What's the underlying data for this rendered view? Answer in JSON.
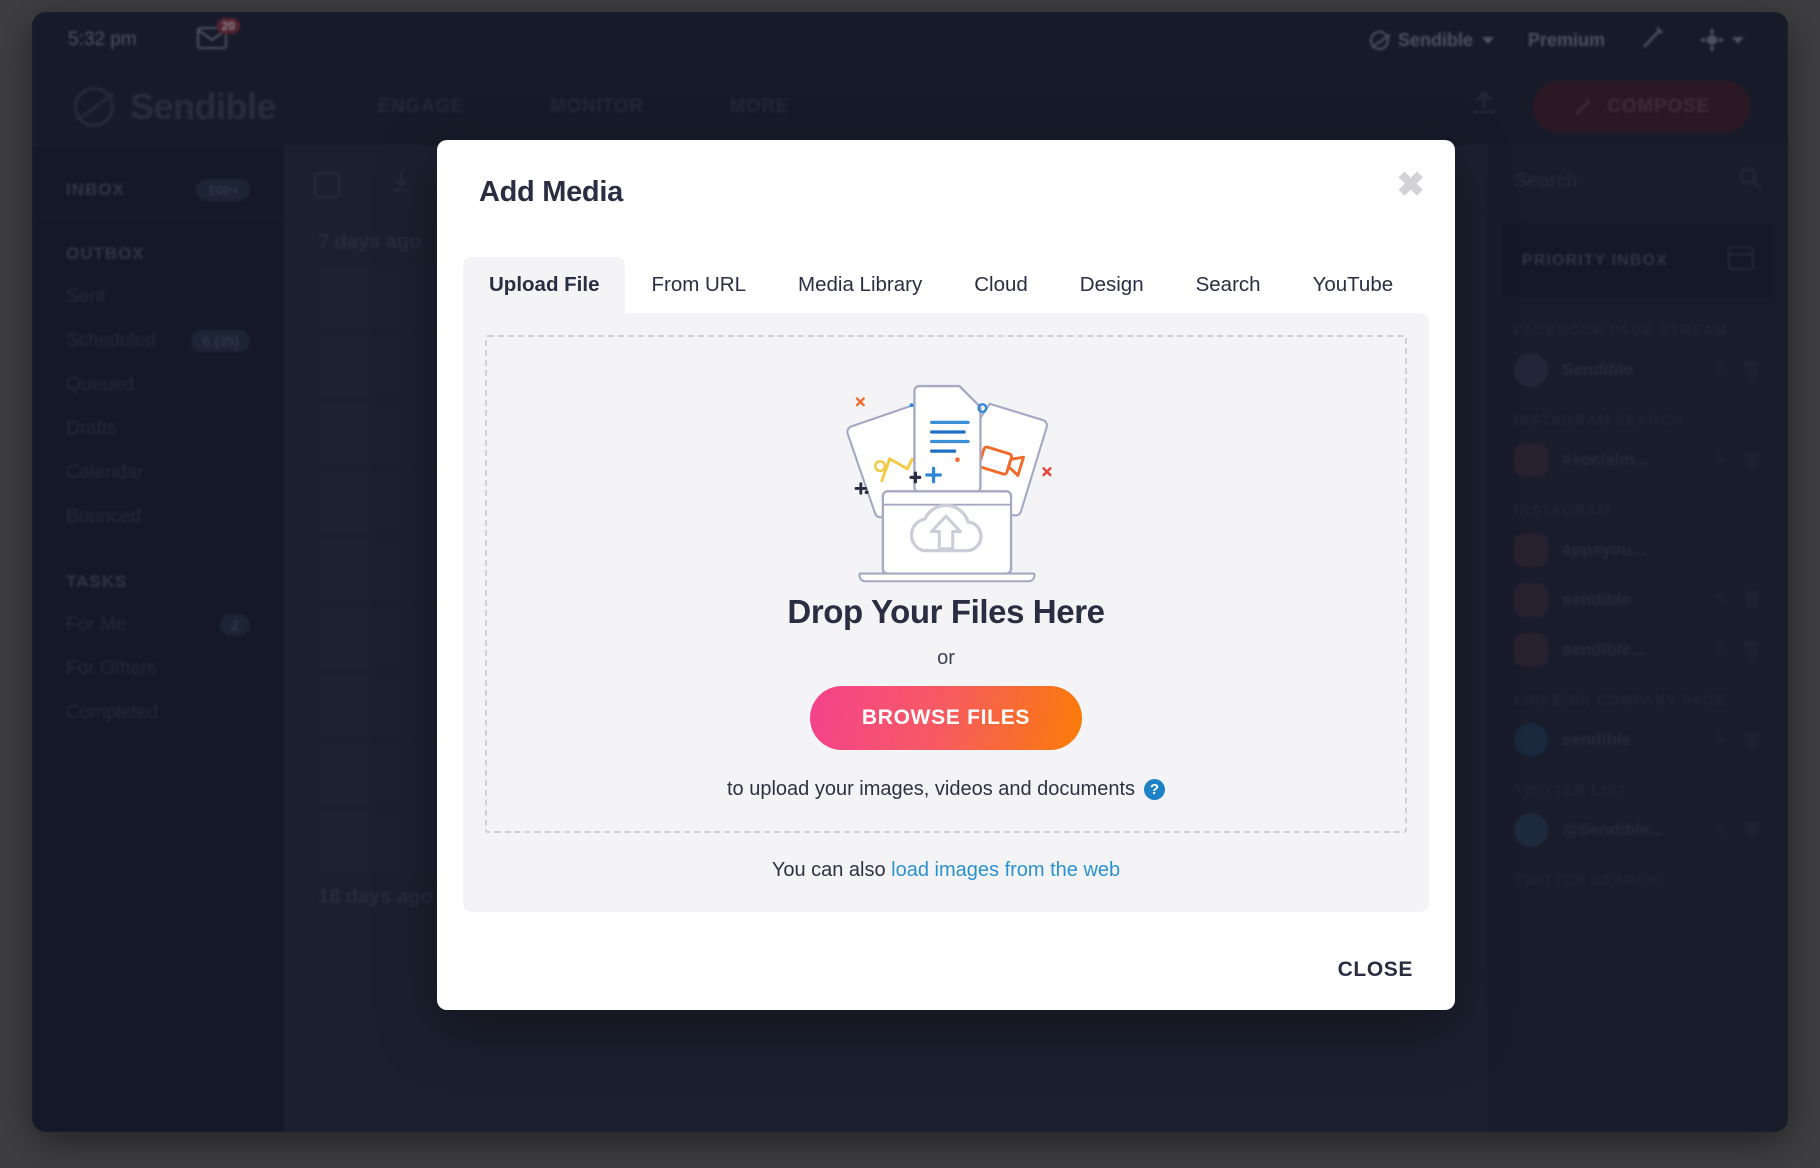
{
  "app": {
    "topbar": {
      "clock": "5:32 pm",
      "mail_badge": "20",
      "account_name": "Sendible",
      "plan": "Premium",
      "compose_label": "COMPOSE"
    },
    "brand": "Sendible",
    "nav": [
      "ENGAGE",
      "MONITOR",
      "MORE"
    ],
    "sidebar": {
      "inbox_label": "INBOX",
      "inbox_badge": "100+",
      "outbox_label": "OUTBOX",
      "outbox_items": [
        {
          "label": "Sent",
          "badge": ""
        },
        {
          "label": "Scheduled",
          "badge": "0 (35)"
        },
        {
          "label": "Queued",
          "badge": ""
        },
        {
          "label": "Drafts",
          "badge": ""
        },
        {
          "label": "Calendar",
          "badge": ""
        },
        {
          "label": "Bounced",
          "badge": ""
        }
      ],
      "tasks_label": "TASKS",
      "tasks_items": [
        {
          "label": "For Me",
          "badge": "2"
        },
        {
          "label": "For Others",
          "badge": ""
        },
        {
          "label": "Completed",
          "badge": ""
        }
      ]
    },
    "center": {
      "date_top": "7 days ago",
      "date_bottom": "18 days ago"
    },
    "rightpane": {
      "search_placeholder": "Search",
      "priority_inbox": "PRIORITY INBOX",
      "sections": [
        {
          "title": "FACEBOOK PAGE STREAM",
          "accounts": [
            {
              "name": "Sendible",
              "type": "fb"
            }
          ]
        },
        {
          "title": "INSTAGRAM SEARCH",
          "accounts": [
            {
              "name": "#socialm...",
              "type": "ig"
            }
          ]
        },
        {
          "title": "INSTAGRAM",
          "accounts": [
            {
              "name": "appsyou...",
              "type": "ig"
            },
            {
              "name": "sendible",
              "type": "ig"
            },
            {
              "name": "sendible...",
              "type": "ig"
            }
          ]
        },
        {
          "title": "LINKEDIN COMPANY PAGE",
          "accounts": [
            {
              "name": "sendible",
              "type": "li"
            }
          ]
        },
        {
          "title": "TWITTER LIST",
          "accounts": [
            {
              "name": "@Sendible...",
              "type": "tw"
            }
          ]
        },
        {
          "title": "TWITTER SEARCH",
          "accounts": []
        }
      ]
    }
  },
  "modal": {
    "title": "Add Media",
    "close_icon": "✖",
    "tabs": [
      {
        "label": "Upload File",
        "active": true
      },
      {
        "label": "From URL",
        "active": false
      },
      {
        "label": "Media Library",
        "active": false
      },
      {
        "label": "Cloud",
        "active": false
      },
      {
        "label": "Design",
        "active": false
      },
      {
        "label": "Search",
        "active": false
      },
      {
        "label": "YouTube",
        "active": false
      }
    ],
    "dropzone": {
      "title": "Drop Your Files Here",
      "or": "or",
      "browse_label": "BROWSE FILES",
      "hint": "to upload your images, videos and documents",
      "help_icon": "?"
    },
    "weblink": {
      "prefix": "You can also ",
      "link": "load images from the web"
    },
    "footer_close": "CLOSE"
  },
  "colors": {
    "app_navy": "#242b44",
    "sidebar_navy": "#1f2640",
    "gradient_start": "#f4428c",
    "gradient_end": "#fb7c06",
    "link_blue": "#2a92d0",
    "help_blue": "#1d81c7",
    "panel_gray": "#f4f4f6",
    "text_dark": "#2b2d42"
  }
}
